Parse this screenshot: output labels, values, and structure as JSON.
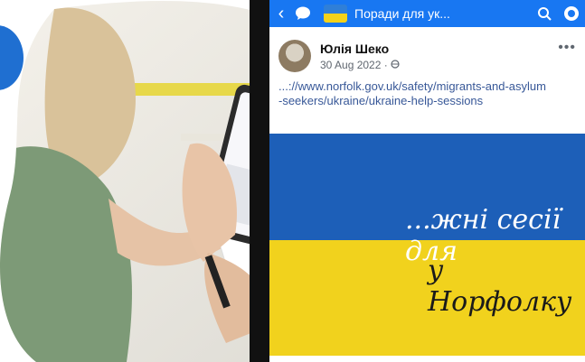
{
  "topbar": {
    "back_icon": "back-arrow-icon",
    "group_title": "Поради для ук...",
    "accent": "#1877f2"
  },
  "post": {
    "author": "Юлія Шеко",
    "meta": "30 Aug 2022 · ",
    "link_text": "...://www.norfolk.gov.uk/safety/migrants-and-asylum-seekers/ukraine/ukraine-help-sessions",
    "banner_line1": "...жні сесії для",
    "banner_line2": "у Норфолку",
    "more": "•••"
  },
  "colors": {
    "flag_blue": "#1d5fb8",
    "flag_yellow": "#f1d21d"
  }
}
